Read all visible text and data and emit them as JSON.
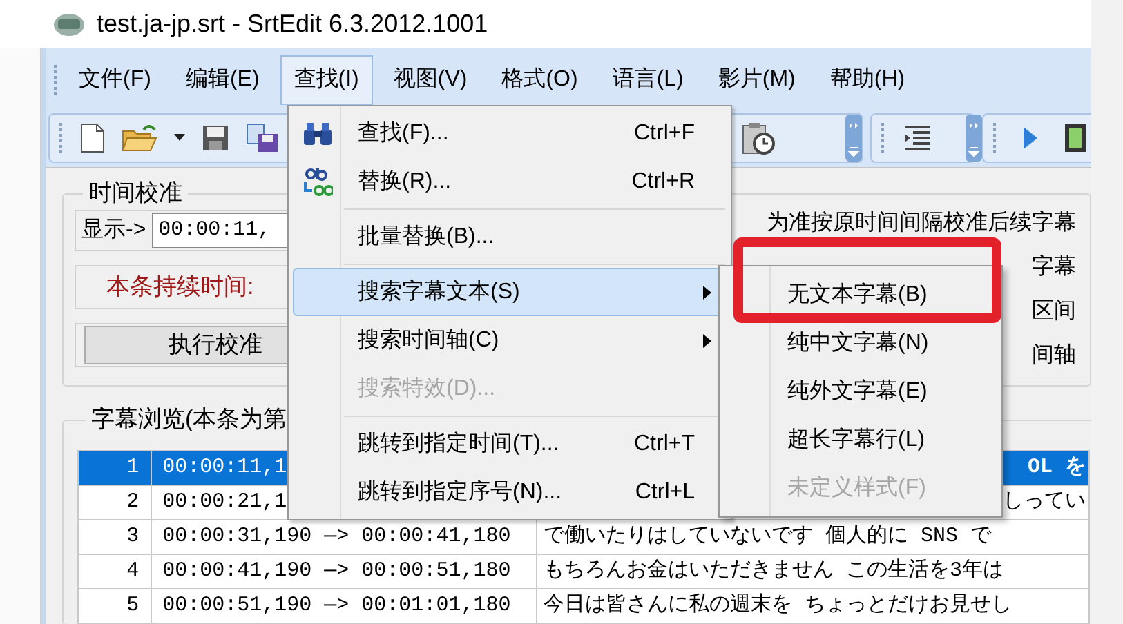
{
  "window": {
    "title": "test.ja-jp.srt - SrtEdit 6.3.2012.1001"
  },
  "menu_bar": [
    {
      "label": "文件(F)",
      "selected": false
    },
    {
      "label": "编辑(E)",
      "selected": false
    },
    {
      "label": "查找(I)",
      "selected": true
    },
    {
      "label": "视图(V)",
      "selected": false
    },
    {
      "label": "格式(O)",
      "selected": false
    },
    {
      "label": "语言(L)",
      "selected": false
    },
    {
      "label": "影片(M)",
      "selected": false
    },
    {
      "label": "帮助(H)",
      "selected": false
    }
  ],
  "time_calibration": {
    "title": "时间校准",
    "display_label": "显示->",
    "display_value": "00:00:11,",
    "duration_label": "本条持续时间:",
    "calibrate_button": "执行校准",
    "notes": [
      "为准按原时间间隔校准后续字幕",
      "字幕",
      "区间",
      "间轴"
    ]
  },
  "subtitle_browser": {
    "title": "字幕浏览(本条为第",
    "rows": [
      {
        "index": "1",
        "time": "00:00:11,1",
        "text": "OL を",
        "selected": true
      },
      {
        "index": "2",
        "time": "00:00:21,1",
        "text": "しってい",
        "selected": false
      },
      {
        "index": "3",
        "time": "00:00:31,190 —> 00:00:41,180",
        "text": "で働いたりはしていないです 個人的に SNS で",
        "selected": false
      },
      {
        "index": "4",
        "time": "00:00:41,190 —> 00:00:51,180",
        "text": "もちろんお金はいただきません この生活を3年は",
        "selected": false
      },
      {
        "index": "5",
        "time": "00:00:51,190 —> 00:01:01,180",
        "text": "今日は皆さんに私の週末を ちょっとだけお見せし",
        "selected": false
      }
    ]
  },
  "find_menu": {
    "items": [
      {
        "kind": "command",
        "label": "查找(F)...",
        "shortcut": "Ctrl+F",
        "selected": false,
        "disabled": false
      },
      {
        "kind": "command",
        "label": "替换(R)...",
        "shortcut": "Ctrl+R",
        "selected": false,
        "disabled": false
      },
      {
        "kind": "separator"
      },
      {
        "kind": "command",
        "label": "批量替换(B)...",
        "selected": false,
        "disabled": false
      },
      {
        "kind": "separator"
      },
      {
        "kind": "submenu",
        "label": "搜索字幕文本(S)",
        "selected": true,
        "disabled": false
      },
      {
        "kind": "submenu",
        "label": "搜索时间轴(C)",
        "selected": false,
        "disabled": false
      },
      {
        "kind": "command",
        "label": "搜索特效(D)...",
        "selected": false,
        "disabled": true
      },
      {
        "kind": "separator"
      },
      {
        "kind": "command",
        "label": "跳转到指定时间(T)...",
        "shortcut": "Ctrl+T",
        "selected": false,
        "disabled": false
      },
      {
        "kind": "command",
        "label": "跳转到指定序号(N)...",
        "shortcut": "Ctrl+L",
        "selected": false,
        "disabled": false
      }
    ]
  },
  "search_text_submenu": {
    "items": [
      {
        "label": "无文本字幕(B)",
        "disabled": false,
        "marked": true
      },
      {
        "label": "纯中文字幕(N)",
        "disabled": false,
        "marked": false
      },
      {
        "label": "纯外文字幕(E)",
        "disabled": false,
        "marked": false
      },
      {
        "label": "超长字幕行(L)",
        "disabled": false,
        "marked": false
      },
      {
        "label": "未定义样式(F)",
        "disabled": true,
        "marked": false
      }
    ]
  }
}
